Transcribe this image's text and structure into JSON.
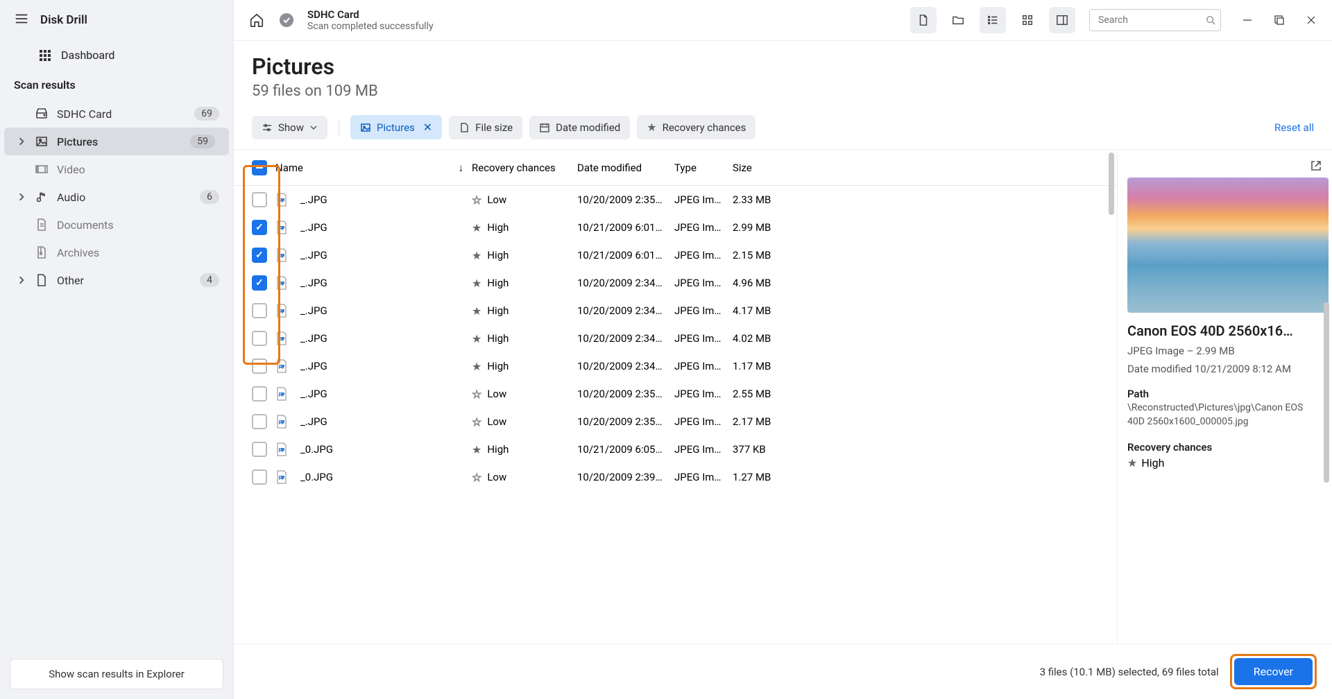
{
  "app": {
    "title": "Disk Drill",
    "dashboard": "Dashboard",
    "section": "Scan results"
  },
  "nav": [
    {
      "label": "SDHC Card",
      "badge": "69",
      "icon": "disk",
      "chevron": false,
      "dim": false
    },
    {
      "label": "Pictures",
      "badge": "59",
      "icon": "pictures",
      "chevron": true,
      "dim": false,
      "active": true
    },
    {
      "label": "Video",
      "badge": "",
      "icon": "video",
      "chevron": false,
      "dim": true
    },
    {
      "label": "Audio",
      "badge": "6",
      "icon": "audio",
      "chevron": true,
      "dim": false
    },
    {
      "label": "Documents",
      "badge": "",
      "icon": "documents",
      "chevron": false,
      "dim": true
    },
    {
      "label": "Archives",
      "badge": "",
      "icon": "archives",
      "chevron": false,
      "dim": true
    },
    {
      "label": "Other",
      "badge": "4",
      "icon": "other",
      "chevron": true,
      "dim": false
    }
  ],
  "sidebar_footer": "Show scan results in Explorer",
  "topbar": {
    "device": "SDHC Card",
    "status": "Scan completed successfully",
    "search_placeholder": "Search"
  },
  "header": {
    "title": "Pictures",
    "subtitle": "59 files on 109 MB"
  },
  "filters": {
    "show": "Show",
    "pictures": "Pictures",
    "filesize": "File size",
    "datemod": "Date modified",
    "recchance": "Recovery chances",
    "reset": "Reset all"
  },
  "columns": {
    "name": "Name",
    "rec": "Recovery chances",
    "date": "Date modified",
    "type": "Type",
    "size": "Size"
  },
  "rows": [
    {
      "name": "_.JPG",
      "rec": "Low",
      "recHigh": false,
      "date": "10/20/2009 2:35…",
      "type": "JPEG Im…",
      "size": "2.33 MB",
      "checked": false
    },
    {
      "name": "_.JPG",
      "rec": "High",
      "recHigh": true,
      "date": "10/21/2009 6:01…",
      "type": "JPEG Im…",
      "size": "2.99 MB",
      "checked": true
    },
    {
      "name": "_.JPG",
      "rec": "High",
      "recHigh": true,
      "date": "10/21/2009 6:01…",
      "type": "JPEG Im…",
      "size": "2.15 MB",
      "checked": true
    },
    {
      "name": "_.JPG",
      "rec": "High",
      "recHigh": true,
      "date": "10/20/2009 2:34…",
      "type": "JPEG Im…",
      "size": "4.96 MB",
      "checked": true
    },
    {
      "name": "_.JPG",
      "rec": "High",
      "recHigh": true,
      "date": "10/20/2009 2:34…",
      "type": "JPEG Im…",
      "size": "4.17 MB",
      "checked": false
    },
    {
      "name": "_.JPG",
      "rec": "High",
      "recHigh": true,
      "date": "10/20/2009 2:34…",
      "type": "JPEG Im…",
      "size": "4.02 MB",
      "checked": false
    },
    {
      "name": "_.JPG",
      "rec": "High",
      "recHigh": true,
      "date": "10/20/2009 2:34…",
      "type": "JPEG Im…",
      "size": "1.17 MB",
      "checked": false
    },
    {
      "name": "_.JPG",
      "rec": "Low",
      "recHigh": false,
      "date": "10/20/2009 2:35…",
      "type": "JPEG Im…",
      "size": "2.55 MB",
      "checked": false
    },
    {
      "name": "_.JPG",
      "rec": "Low",
      "recHigh": false,
      "date": "10/20/2009 2:35…",
      "type": "JPEG Im…",
      "size": "2.17 MB",
      "checked": false
    },
    {
      "name": "_0.JPG",
      "rec": "High",
      "recHigh": true,
      "date": "10/21/2009 6:05…",
      "type": "JPEG Im…",
      "size": "377 KB",
      "checked": false
    },
    {
      "name": "_0.JPG",
      "rec": "Low",
      "recHigh": false,
      "date": "10/20/2009 2:39…",
      "type": "JPEG Im…",
      "size": "1.27 MB",
      "checked": false
    }
  ],
  "preview": {
    "title": "Canon EOS 40D 2560x16…",
    "meta1": "JPEG Image – 2.99 MB",
    "meta2": "Date modified 10/21/2009 8:12 AM",
    "path_label": "Path",
    "path_value": "\\Reconstructed\\Pictures\\jpg\\Canon EOS 40D 2560x1600_000005.jpg",
    "rec_label": "Recovery chances",
    "rec_value": "High"
  },
  "footer": {
    "status": "3 files (10.1 MB) selected, 69 files total",
    "recover": "Recover"
  }
}
